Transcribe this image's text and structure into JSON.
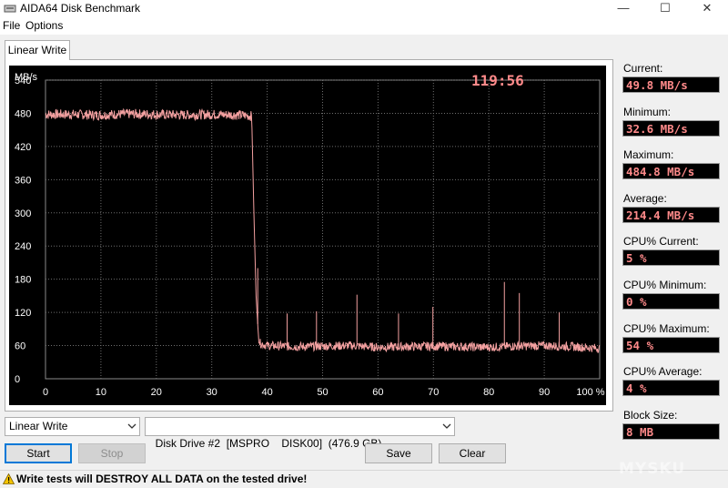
{
  "window": {
    "title": "AIDA64 Disk Benchmark",
    "controls": {
      "minimize": "—",
      "maximize": "☐",
      "close": "✕"
    }
  },
  "menu": [
    {
      "label": "File"
    },
    {
      "label": "Options"
    }
  ],
  "tab": {
    "label": "Linear Write"
  },
  "graph": {
    "timer": "119:56",
    "background": "#000000",
    "line_color": "#f3a0a0",
    "timer_color": "#ff8a8a"
  },
  "stats": [
    {
      "label": "Current:",
      "value": "49.8 MB/s"
    },
    {
      "label": "Minimum:",
      "value": "32.6 MB/s"
    },
    {
      "label": "Maximum:",
      "value": "484.8 MB/s"
    },
    {
      "label": "Average:",
      "value": "214.4 MB/s"
    },
    {
      "label": "CPU% Current:",
      "value": "5 %"
    },
    {
      "label": "CPU% Minimum:",
      "value": "0 %"
    },
    {
      "label": "CPU% Maximum:",
      "value": "54 %"
    },
    {
      "label": "CPU% Average:",
      "value": "4 %"
    },
    {
      "label": "Block Size:",
      "value": "8 MB"
    }
  ],
  "controls": {
    "test_select": "Linear Write",
    "drive_select": "Disk Drive #2  [MSPRO    DISK00]  (476.9 GB)",
    "start": "Start",
    "stop": "Stop",
    "save": "Save",
    "clear": "Clear"
  },
  "status": {
    "warning": "Write tests will DESTROY ALL DATA on the tested drive!"
  },
  "watermark": "MYSKU",
  "chart_data": {
    "type": "line",
    "title": "",
    "ylabel": "MB/s",
    "xlabel": "",
    "xlim": [
      0,
      100
    ],
    "ylim": [
      0,
      540
    ],
    "y_ticks": [
      "0",
      "60",
      "120",
      "180",
      "240",
      "300",
      "360",
      "420",
      "480",
      "540"
    ],
    "x_ticks": [
      "0",
      "10",
      "20",
      "30",
      "40",
      "50",
      "60",
      "70",
      "80",
      "90",
      "100 %"
    ],
    "grid": true,
    "series": [
      {
        "x": [
          0,
          5,
          10,
          15,
          20,
          25,
          30,
          35,
          37.2,
          37.6,
          38,
          38.5,
          40,
          45,
          50,
          55,
          60,
          65,
          70,
          75,
          80,
          85,
          90,
          95,
          100
        ],
        "y": [
          478,
          478,
          477,
          479,
          478,
          477,
          478,
          477,
          475,
          300,
          150,
          65,
          60,
          58,
          59,
          60,
          57,
          58,
          59,
          58,
          57,
          59,
          60,
          58,
          55
        ]
      }
    ],
    "spikes": [
      {
        "x": 38.3,
        "y": 200
      },
      {
        "x": 43.6,
        "y": 118
      },
      {
        "x": 48.9,
        "y": 122
      },
      {
        "x": 56.2,
        "y": 152
      },
      {
        "x": 63.7,
        "y": 118
      },
      {
        "x": 69.9,
        "y": 130
      },
      {
        "x": 82.8,
        "y": 175
      },
      {
        "x": 85.5,
        "y": 155
      },
      {
        "x": 92.7,
        "y": 120
      }
    ]
  }
}
